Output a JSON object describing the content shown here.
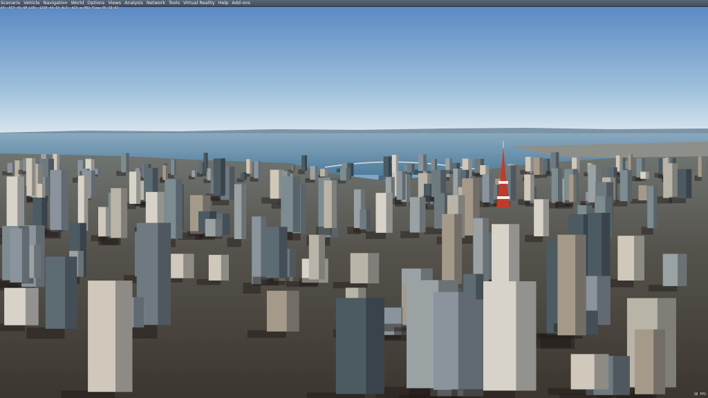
{
  "menubar": {
    "items": [
      "Scenario",
      "Vehicle",
      "Navigation",
      "World",
      "Options",
      "Views",
      "Analysis",
      "Network",
      "Tools",
      "Virtual Reality",
      "Help",
      "Add-ons"
    ]
  },
  "status_readout": "AT: 857  45.6M  LON: 139F  44.07  ALT: 425 m  HDG  Time 05:58:02",
  "fps_readout": "38 FPS",
  "scene": {
    "sky_top": "#5b89c4",
    "sky_horizon": "#d7e4ee",
    "sea": "#6d94ad",
    "ground": "#4e4a45",
    "landmark": "tokyo-tower"
  }
}
